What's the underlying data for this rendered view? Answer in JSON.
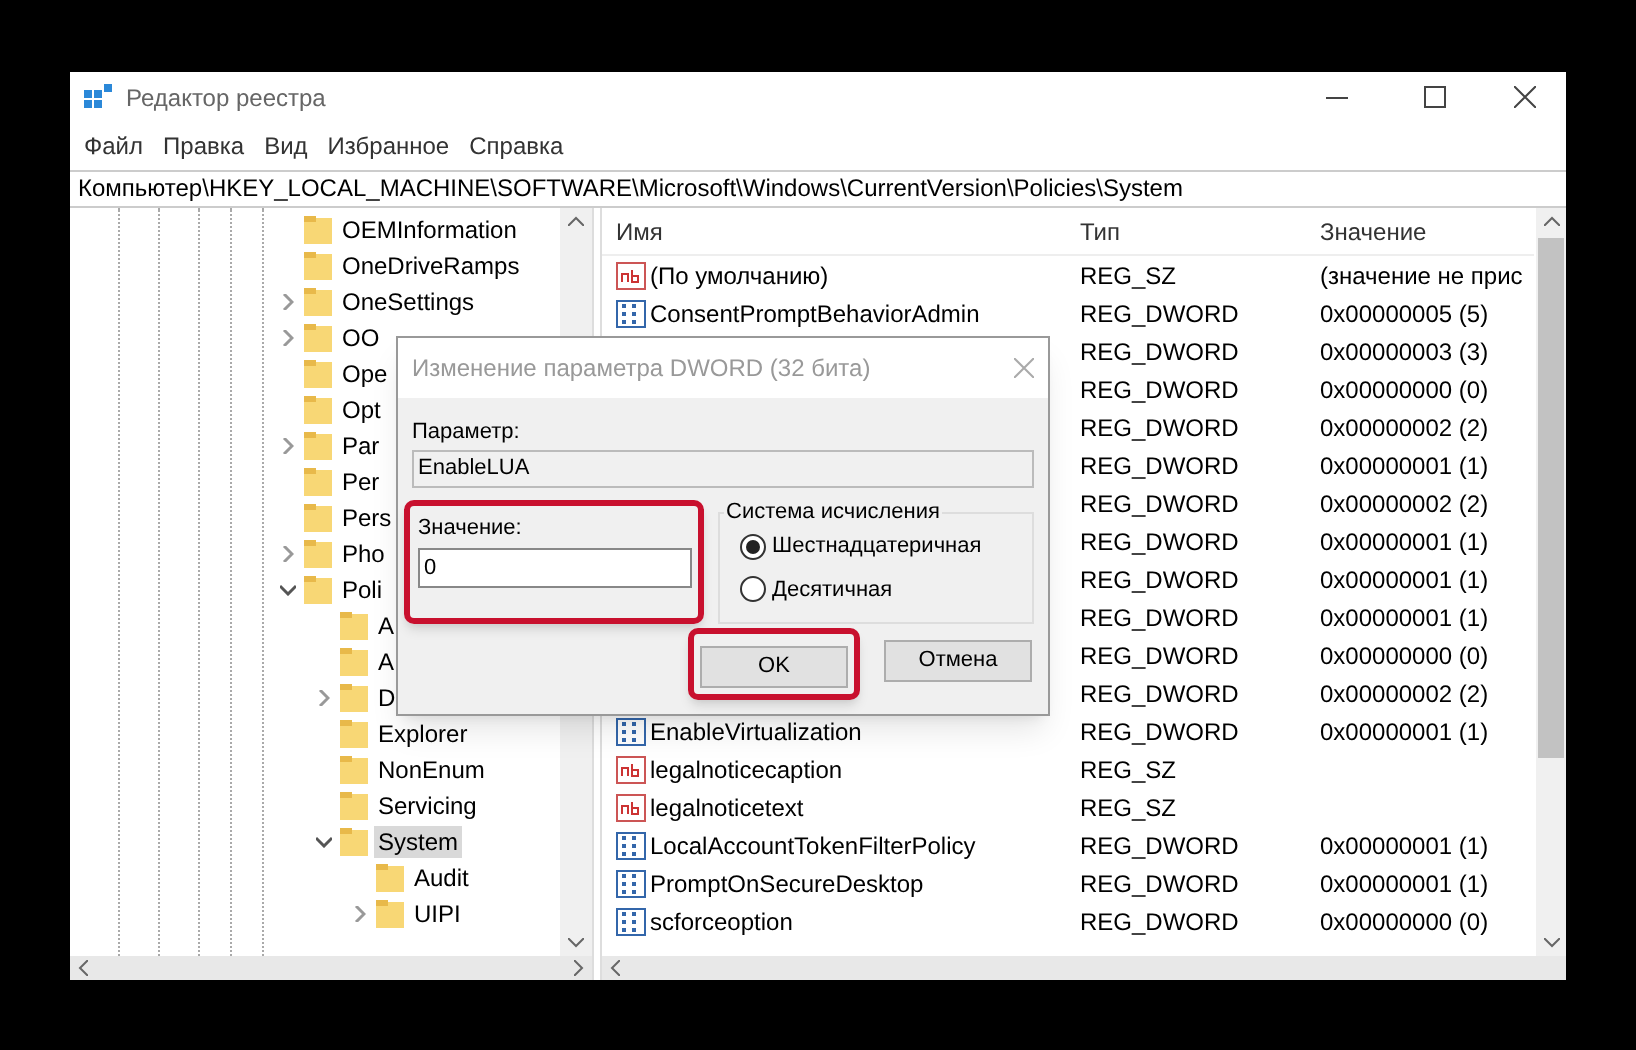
{
  "window": {
    "title": "Редактор реестра"
  },
  "menu": [
    "Файл",
    "Правка",
    "Вид",
    "Избранное",
    "Справка"
  ],
  "address": "Компьютер\\HKEY_LOCAL_MACHINE\\SOFTWARE\\Microsoft\\Windows\\CurrentVersion\\Policies\\System",
  "tree": [
    {
      "label": "OEMInformation",
      "selected": false
    },
    {
      "label": "OneDriveRamps",
      "selected": false
    },
    {
      "label": "OneSettings",
      "expanded": false,
      "selected": false
    },
    {
      "label": "OO",
      "expanded": false,
      "selected": false
    },
    {
      "label": "Ope",
      "selected": false
    },
    {
      "label": "Opt",
      "selected": false
    },
    {
      "label": "Par",
      "expanded": false,
      "selected": false
    },
    {
      "label": "Per",
      "selected": false
    },
    {
      "label": "Pers",
      "selected": false
    },
    {
      "label": "Pho",
      "expanded": false,
      "selected": false
    },
    {
      "label": "Poli",
      "expanded": true,
      "selected": false,
      "children": [
        {
          "label": "A",
          "selected": false
        },
        {
          "label": "A",
          "selected": false
        },
        {
          "label": "D",
          "expanded": false,
          "selected": false
        },
        {
          "label": "Explorer",
          "selected": false
        },
        {
          "label": "NonEnum",
          "selected": false
        },
        {
          "label": "Servicing",
          "selected": false
        },
        {
          "label": "System",
          "expanded": true,
          "selected": true,
          "children": [
            {
              "label": "Audit",
              "selected": false
            },
            {
              "label": "UIPI",
              "expanded": false,
              "selected": false
            }
          ]
        }
      ]
    }
  ],
  "table": {
    "columns": [
      "Имя",
      "Тип",
      "Значение"
    ],
    "rows": [
      {
        "kind": "string",
        "name": "(По умолчанию)",
        "type": "REG_SZ",
        "value": "(значение не прис"
      },
      {
        "kind": "dword",
        "name": "ConsentPromptBehaviorAdmin",
        "type": "REG_DWORD",
        "value": "0x00000005 (5)"
      },
      {
        "kind": "hidden",
        "type": "REG_DWORD",
        "value": "0x00000003 (3)"
      },
      {
        "kind": "hidden",
        "type": "REG_DWORD",
        "value": "0x00000000 (0)"
      },
      {
        "kind": "hidden",
        "type": "REG_DWORD",
        "value": "0x00000002 (2)"
      },
      {
        "kind": "hidden",
        "type": "REG_DWORD",
        "value": "0x00000001 (1)"
      },
      {
        "kind": "hidden",
        "type": "REG_DWORD",
        "value": "0x00000002 (2)"
      },
      {
        "kind": "hidden",
        "type": "REG_DWORD",
        "value": "0x00000001 (1)"
      },
      {
        "kind": "hidden",
        "type": "REG_DWORD",
        "value": "0x00000001 (1)"
      },
      {
        "kind": "hidden",
        "type": "REG_DWORD",
        "value": "0x00000001 (1)"
      },
      {
        "kind": "hidden",
        "type": "REG_DWORD",
        "value": "0x00000000 (0)"
      },
      {
        "kind": "hidden",
        "type": "REG_DWORD",
        "value": "0x00000002 (2)"
      },
      {
        "kind": "dword",
        "name": "EnableVirtualization",
        "type": "REG_DWORD",
        "value": "0x00000001 (1)"
      },
      {
        "kind": "string",
        "name": "legalnoticecaption",
        "type": "REG_SZ"
      },
      {
        "kind": "string",
        "name": "legalnoticetext",
        "type": "REG_SZ"
      },
      {
        "kind": "dword",
        "name": "LocalAccountTokenFilterPolicy",
        "type": "REG_DWORD",
        "value": "0x00000001 (1)"
      },
      {
        "kind": "dword",
        "name": "PromptOnSecureDesktop",
        "type": "REG_DWORD",
        "value": "0x00000001 (1)"
      },
      {
        "kind": "dword",
        "name": "scforceoption",
        "type": "REG_DWORD",
        "value": "0x00000000 (0)"
      }
    ]
  },
  "dialog": {
    "title": "Изменение параметра DWORD (32 бита)",
    "name_label": "Параметр:",
    "name_value": "EnableLUA",
    "value_label": "Значение:",
    "value": "0",
    "value_highlighted": true,
    "base_group": "Система исчисления",
    "bases": [
      {
        "label": "Шестнадцатеричная",
        "selected": true
      },
      {
        "label": "Десятичная",
        "selected": false
      }
    ],
    "buttons": [
      {
        "label": "OK",
        "highlighted": true
      },
      {
        "label": "Отмена",
        "highlighted": false
      }
    ]
  }
}
